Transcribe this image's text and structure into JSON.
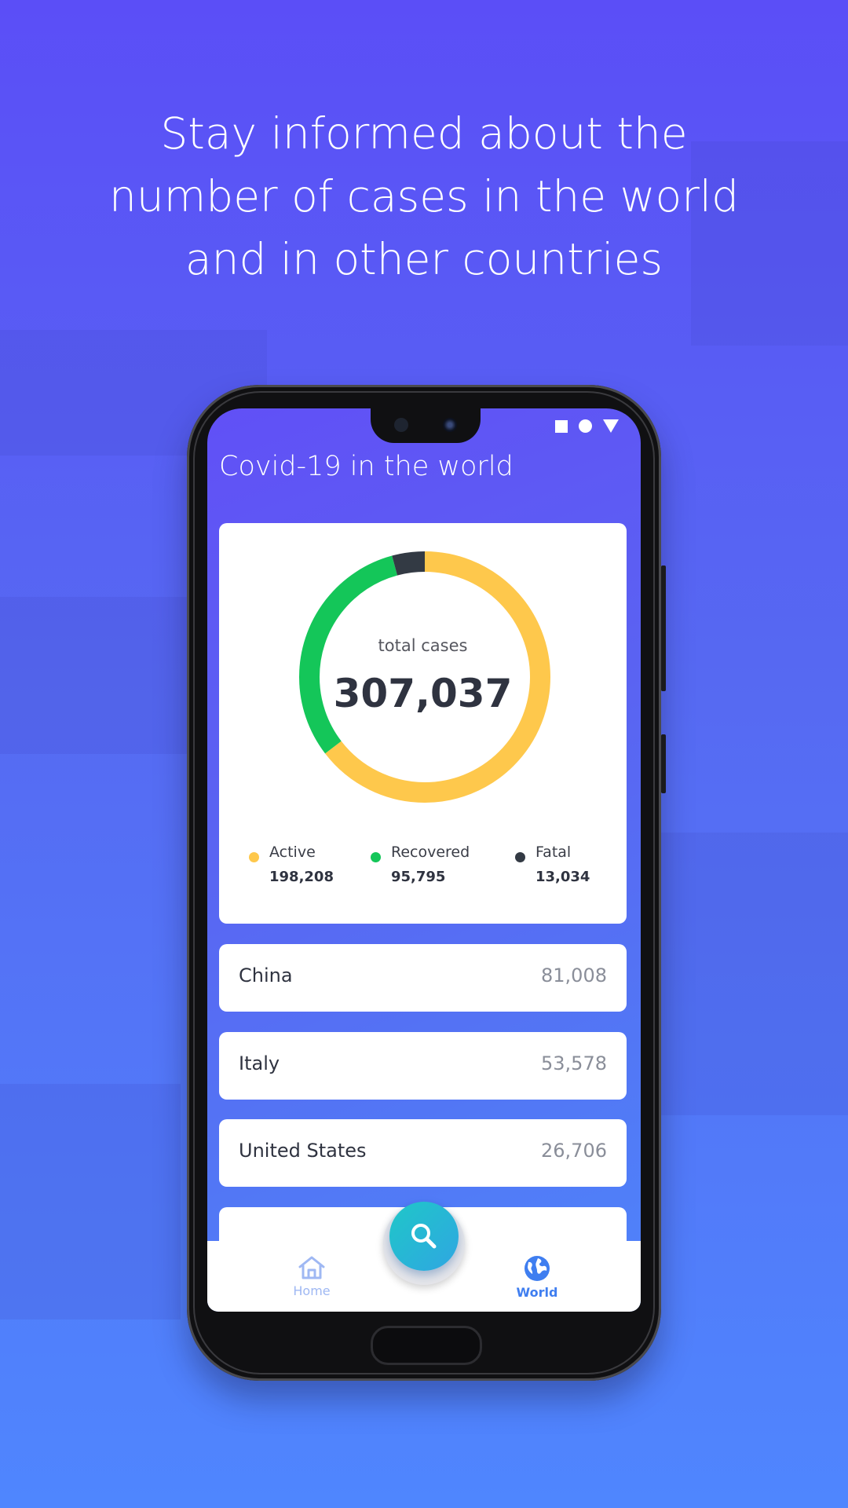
{
  "headline": {
    "line1": "Stay informed about the",
    "line2": "number of cases in the world",
    "line3": "and in other countries"
  },
  "app": {
    "title": "Covid-19 in the world"
  },
  "summary": {
    "label": "total cases",
    "total": "307,037",
    "legend": [
      {
        "name": "Active",
        "value": "198,208",
        "color": "#fec84c"
      },
      {
        "name": "Recovered",
        "value": "95,795",
        "color": "#14c659"
      },
      {
        "name": "Fatal",
        "value": "13,034",
        "color": "#333a44"
      }
    ]
  },
  "countries": [
    {
      "name": "China",
      "cases": "81,008"
    },
    {
      "name": "Italy",
      "cases": "53,578"
    },
    {
      "name": "United States",
      "cases": "26,706"
    }
  ],
  "nav": {
    "home_label": "Home",
    "world_label": "World",
    "search_icon": "search-icon"
  },
  "colors": {
    "accent": "#3f7ef0",
    "fab": "#1fc7c8",
    "active": "#fec84c",
    "recovered": "#14c659",
    "fatal": "#333a44"
  }
}
